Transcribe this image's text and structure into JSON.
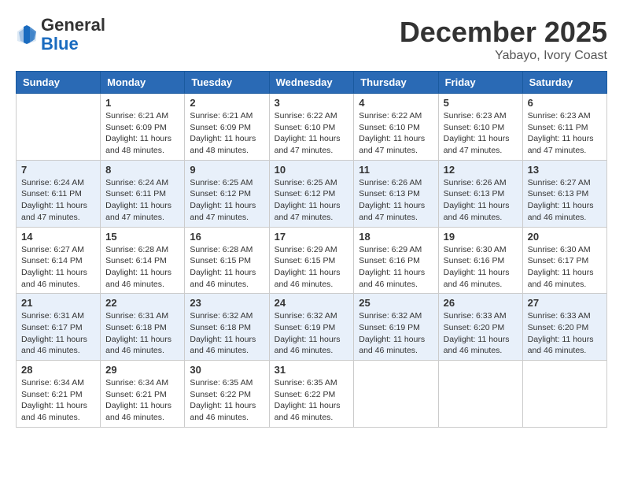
{
  "header": {
    "logo_general": "General",
    "logo_blue": "Blue",
    "month_year": "December 2025",
    "location": "Yabayo, Ivory Coast"
  },
  "days_of_week": [
    "Sunday",
    "Monday",
    "Tuesday",
    "Wednesday",
    "Thursday",
    "Friday",
    "Saturday"
  ],
  "weeks": [
    [
      {
        "day": "",
        "info": ""
      },
      {
        "day": "1",
        "info": "Sunrise: 6:21 AM\nSunset: 6:09 PM\nDaylight: 11 hours and 48 minutes."
      },
      {
        "day": "2",
        "info": "Sunrise: 6:21 AM\nSunset: 6:09 PM\nDaylight: 11 hours and 48 minutes."
      },
      {
        "day": "3",
        "info": "Sunrise: 6:22 AM\nSunset: 6:10 PM\nDaylight: 11 hours and 47 minutes."
      },
      {
        "day": "4",
        "info": "Sunrise: 6:22 AM\nSunset: 6:10 PM\nDaylight: 11 hours and 47 minutes."
      },
      {
        "day": "5",
        "info": "Sunrise: 6:23 AM\nSunset: 6:10 PM\nDaylight: 11 hours and 47 minutes."
      },
      {
        "day": "6",
        "info": "Sunrise: 6:23 AM\nSunset: 6:11 PM\nDaylight: 11 hours and 47 minutes."
      }
    ],
    [
      {
        "day": "7",
        "info": "Sunrise: 6:24 AM\nSunset: 6:11 PM\nDaylight: 11 hours and 47 minutes."
      },
      {
        "day": "8",
        "info": "Sunrise: 6:24 AM\nSunset: 6:11 PM\nDaylight: 11 hours and 47 minutes."
      },
      {
        "day": "9",
        "info": "Sunrise: 6:25 AM\nSunset: 6:12 PM\nDaylight: 11 hours and 47 minutes."
      },
      {
        "day": "10",
        "info": "Sunrise: 6:25 AM\nSunset: 6:12 PM\nDaylight: 11 hours and 47 minutes."
      },
      {
        "day": "11",
        "info": "Sunrise: 6:26 AM\nSunset: 6:13 PM\nDaylight: 11 hours and 47 minutes."
      },
      {
        "day": "12",
        "info": "Sunrise: 6:26 AM\nSunset: 6:13 PM\nDaylight: 11 hours and 46 minutes."
      },
      {
        "day": "13",
        "info": "Sunrise: 6:27 AM\nSunset: 6:13 PM\nDaylight: 11 hours and 46 minutes."
      }
    ],
    [
      {
        "day": "14",
        "info": "Sunrise: 6:27 AM\nSunset: 6:14 PM\nDaylight: 11 hours and 46 minutes."
      },
      {
        "day": "15",
        "info": "Sunrise: 6:28 AM\nSunset: 6:14 PM\nDaylight: 11 hours and 46 minutes."
      },
      {
        "day": "16",
        "info": "Sunrise: 6:28 AM\nSunset: 6:15 PM\nDaylight: 11 hours and 46 minutes."
      },
      {
        "day": "17",
        "info": "Sunrise: 6:29 AM\nSunset: 6:15 PM\nDaylight: 11 hours and 46 minutes."
      },
      {
        "day": "18",
        "info": "Sunrise: 6:29 AM\nSunset: 6:16 PM\nDaylight: 11 hours and 46 minutes."
      },
      {
        "day": "19",
        "info": "Sunrise: 6:30 AM\nSunset: 6:16 PM\nDaylight: 11 hours and 46 minutes."
      },
      {
        "day": "20",
        "info": "Sunrise: 6:30 AM\nSunset: 6:17 PM\nDaylight: 11 hours and 46 minutes."
      }
    ],
    [
      {
        "day": "21",
        "info": "Sunrise: 6:31 AM\nSunset: 6:17 PM\nDaylight: 11 hours and 46 minutes."
      },
      {
        "day": "22",
        "info": "Sunrise: 6:31 AM\nSunset: 6:18 PM\nDaylight: 11 hours and 46 minutes."
      },
      {
        "day": "23",
        "info": "Sunrise: 6:32 AM\nSunset: 6:18 PM\nDaylight: 11 hours and 46 minutes."
      },
      {
        "day": "24",
        "info": "Sunrise: 6:32 AM\nSunset: 6:19 PM\nDaylight: 11 hours and 46 minutes."
      },
      {
        "day": "25",
        "info": "Sunrise: 6:32 AM\nSunset: 6:19 PM\nDaylight: 11 hours and 46 minutes."
      },
      {
        "day": "26",
        "info": "Sunrise: 6:33 AM\nSunset: 6:20 PM\nDaylight: 11 hours and 46 minutes."
      },
      {
        "day": "27",
        "info": "Sunrise: 6:33 AM\nSunset: 6:20 PM\nDaylight: 11 hours and 46 minutes."
      }
    ],
    [
      {
        "day": "28",
        "info": "Sunrise: 6:34 AM\nSunset: 6:21 PM\nDaylight: 11 hours and 46 minutes."
      },
      {
        "day": "29",
        "info": "Sunrise: 6:34 AM\nSunset: 6:21 PM\nDaylight: 11 hours and 46 minutes."
      },
      {
        "day": "30",
        "info": "Sunrise: 6:35 AM\nSunset: 6:22 PM\nDaylight: 11 hours and 46 minutes."
      },
      {
        "day": "31",
        "info": "Sunrise: 6:35 AM\nSunset: 6:22 PM\nDaylight: 11 hours and 46 minutes."
      },
      {
        "day": "",
        "info": ""
      },
      {
        "day": "",
        "info": ""
      },
      {
        "day": "",
        "info": ""
      }
    ]
  ]
}
